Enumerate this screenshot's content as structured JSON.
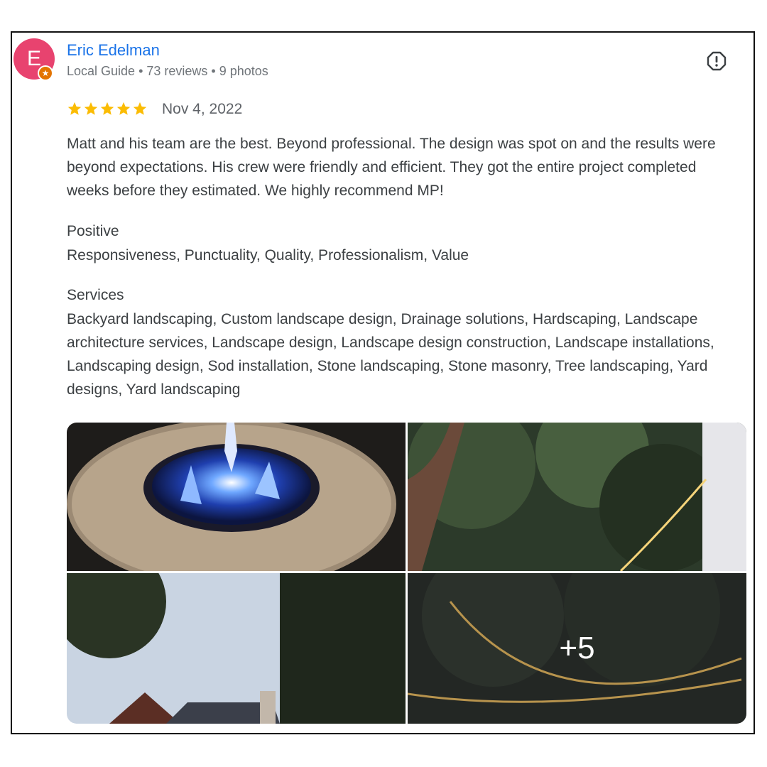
{
  "reviewer": {
    "initial": "E",
    "name": "Eric Edelman",
    "meta": "Local Guide • 73 reviews • 9 photos"
  },
  "review": {
    "rating": 5,
    "date": "Nov 4, 2022",
    "text": "Matt and his team are the best. Beyond professional. The design was spot on and the results were beyond expectations. His crew were friendly and efficient. They got the entire project completed weeks before they estimated. We highly recommend MP!"
  },
  "positive": {
    "heading": "Positive",
    "body": "Responsiveness, Punctuality, Quality, Professionalism, Value"
  },
  "services": {
    "heading": "Services",
    "body": "Backyard landscaping, Custom landscape design, Drainage solutions, Hardscaping, Landscape architecture services, Landscape design, Landscape design construction, Landscape installations, Landscaping design, Sod installation, Stone landscaping, Stone masonry, Tree landscaping, Yard designs, Yard landscaping"
  },
  "photos": {
    "more_label": "+5",
    "items": [
      "fire-pit-photo",
      "string-lights-trees-photo",
      "house-sky-trees-photo",
      "string-lights-evening-photo"
    ]
  },
  "icons": {
    "report": "report-icon",
    "star": "star-icon",
    "local_guide_badge": "star-badge-icon"
  },
  "colors": {
    "name_link": "#1a73e8",
    "star": "#fbbc04",
    "avatar_bg": "#e8436f",
    "badge": "#e37400"
  }
}
